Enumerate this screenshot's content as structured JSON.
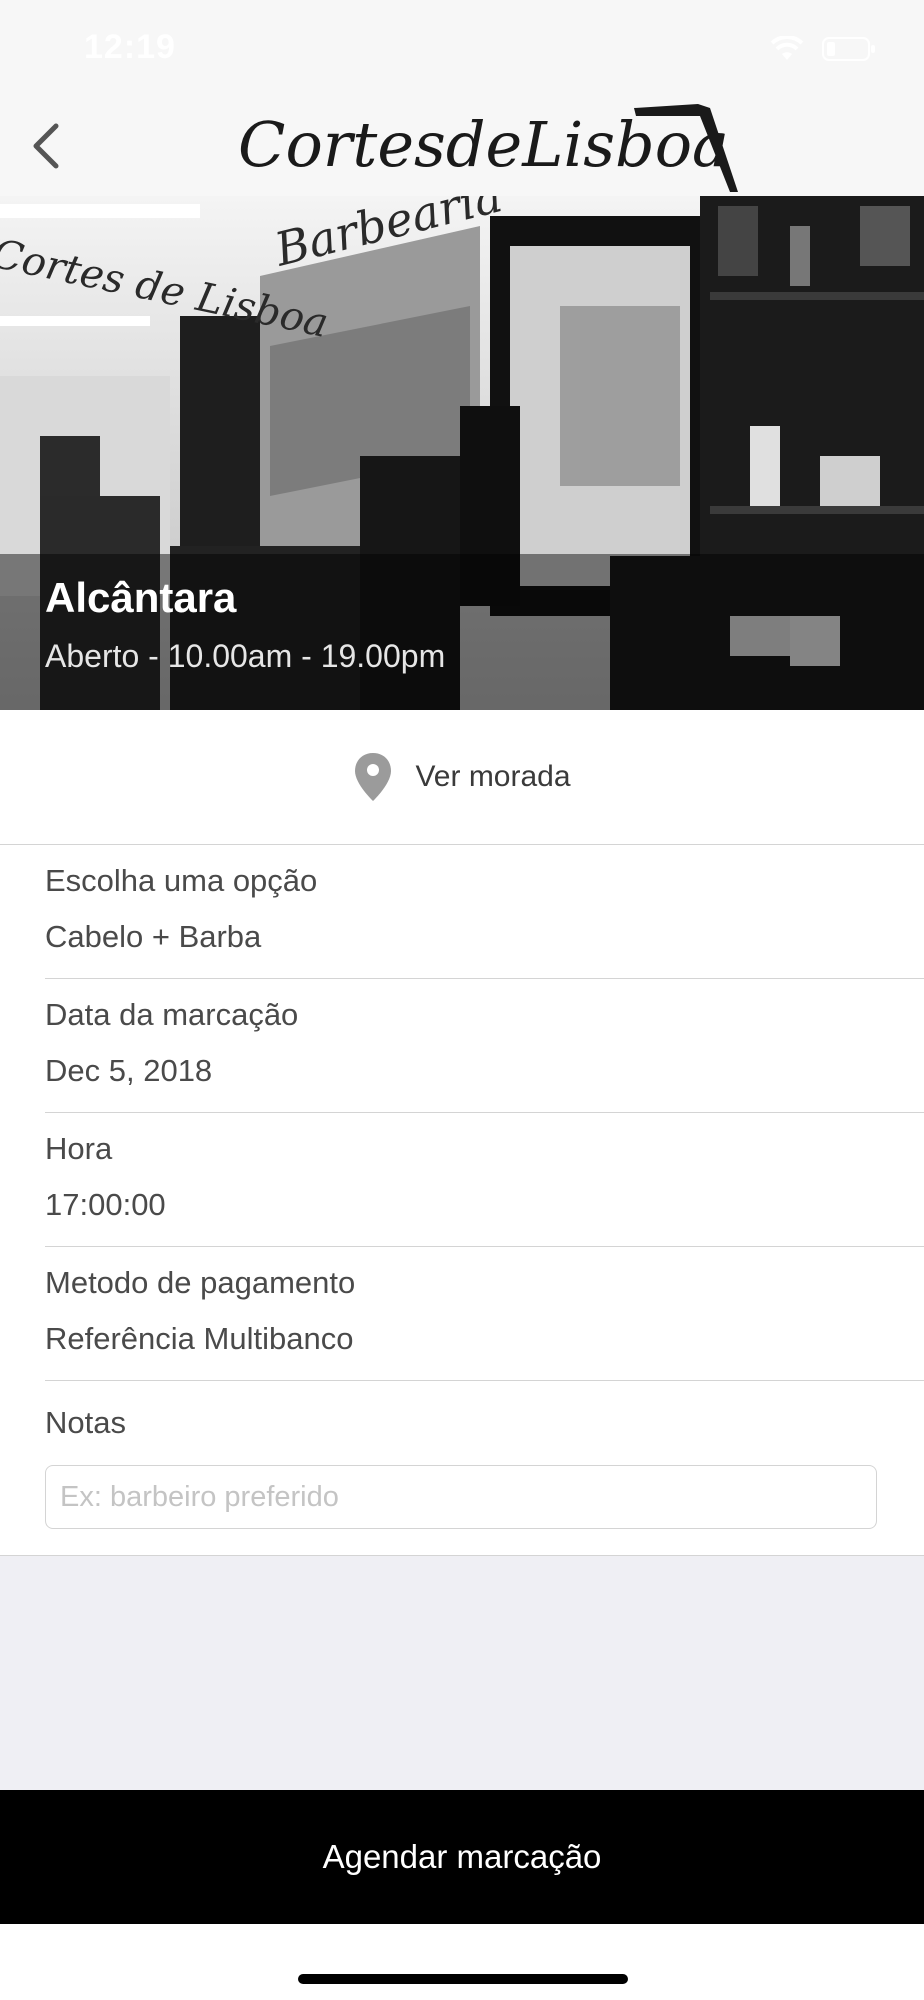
{
  "status_bar": {
    "time": "12:19",
    "icons": [
      "wifi-icon",
      "battery-icon"
    ]
  },
  "nav": {
    "back_icon": "chevron-left-icon",
    "logo_text": "CortesdeLisboa"
  },
  "hero": {
    "title": "Alcântara",
    "hours": "Aberto - 10.00am - 19.00pm",
    "image_signage": [
      "Barbearia",
      "Cortes de Lisboa"
    ]
  },
  "address": {
    "icon": "map-pin-icon",
    "label": "Ver morada"
  },
  "form": {
    "fields": [
      {
        "label": "Escolha uma opção",
        "value": "Cabelo + Barba"
      },
      {
        "label": "Data da marcação",
        "value": "Dec 5, 2018"
      },
      {
        "label": "Hora",
        "value": "17:00:00"
      },
      {
        "label": "Metodo de pagamento",
        "value": "Referência Multibanco"
      }
    ],
    "notes": {
      "label": "Notas",
      "placeholder": "Ex: barbeiro preferido"
    }
  },
  "cta": {
    "label": "Agendar marcação"
  },
  "colors": {
    "accent": "#000000",
    "background": "#efeff4"
  }
}
